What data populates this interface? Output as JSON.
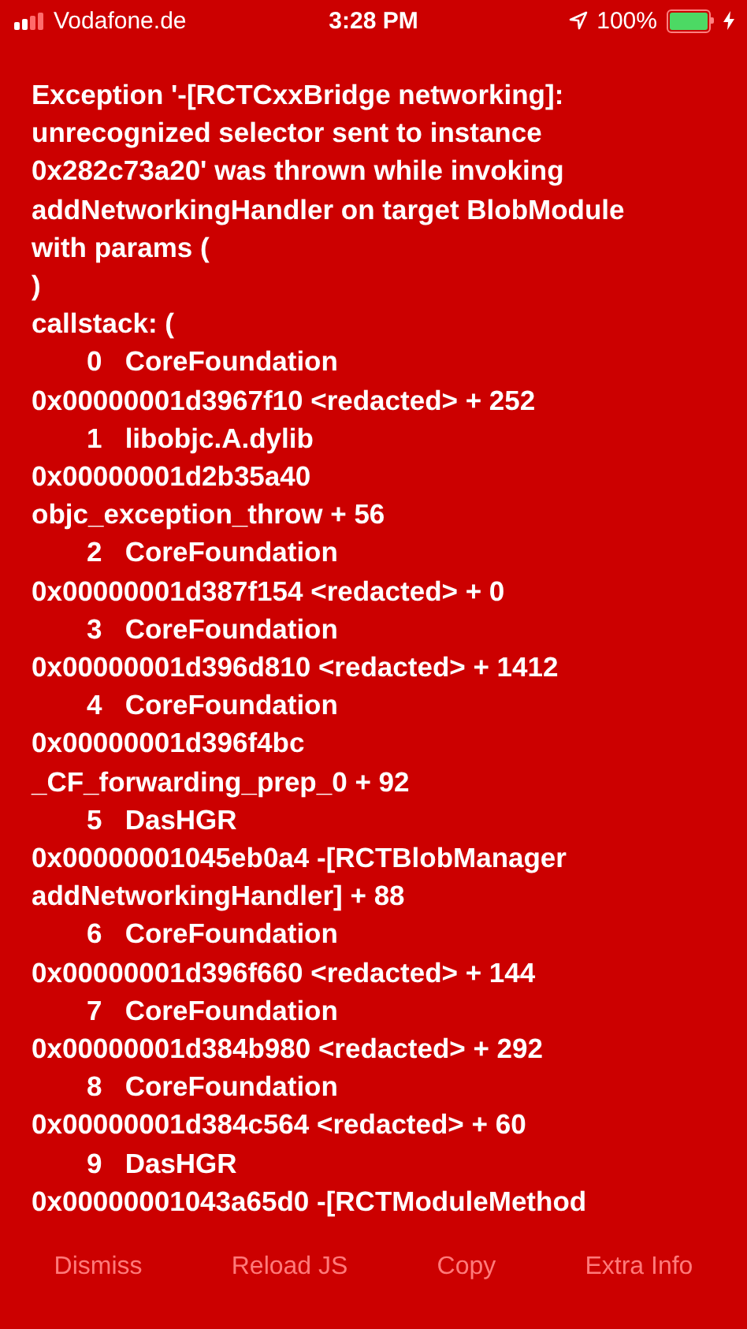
{
  "status_bar": {
    "carrier": "Vodafone.de",
    "time": "3:28 PM",
    "battery": "100%",
    "battery_meter": {
      "level": 1
    }
  },
  "message_lines": [
    "Exception '-[RCTCxxBridge networking]:",
    "unrecognized selector sent to instance",
    "0x282c73a20' was thrown while invoking",
    "addNetworkingHandler on target BlobModule",
    "with params (",
    ")",
    "callstack: ("
  ],
  "frames": [
    {
      "index": "0",
      "module": "CoreFoundation",
      "lines": [
        "0x00000001d3967f10 <redacted> + 252"
      ]
    },
    {
      "index": "1",
      "module": "libobjc.A.dylib",
      "lines": [
        "0x00000001d2b35a40",
        "objc_exception_throw + 56"
      ]
    },
    {
      "index": "2",
      "module": "CoreFoundation",
      "lines": [
        "0x00000001d387f154 <redacted> + 0"
      ]
    },
    {
      "index": "3",
      "module": "CoreFoundation",
      "lines": [
        "0x00000001d396d810 <redacted> + 1412"
      ]
    },
    {
      "index": "4",
      "module": "CoreFoundation",
      "lines": [
        "0x00000001d396f4bc",
        "_CF_forwarding_prep_0 + 92"
      ]
    },
    {
      "index": "5",
      "module": "DasHGR",
      "lines": [
        "0x00000001045eb0a4 -[RCTBlobManager",
        "addNetworkingHandler] + 88"
      ]
    },
    {
      "index": "6",
      "module": "CoreFoundation",
      "lines": [
        "0x00000001d396f660 <redacted> + 144"
      ]
    },
    {
      "index": "7",
      "module": "CoreFoundation",
      "lines": [
        "0x00000001d384b980 <redacted> + 292"
      ]
    },
    {
      "index": "8",
      "module": "CoreFoundation",
      "lines": [
        "0x00000001d384c564 <redacted> + 60"
      ]
    },
    {
      "index": "9",
      "module": "DasHGR",
      "lines": [
        "0x00000001043a65d0 -[RCTModuleMethod"
      ]
    }
  ],
  "buttons": [
    "Dismiss",
    "Reload JS",
    "Copy",
    "Extra Info"
  ]
}
